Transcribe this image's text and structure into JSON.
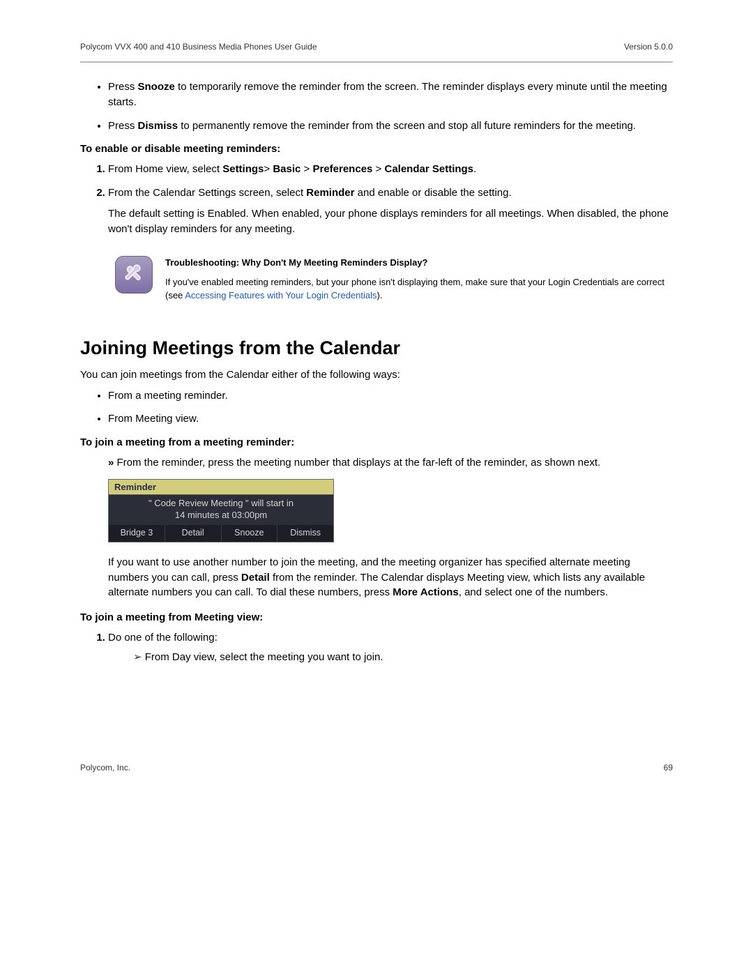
{
  "header": {
    "docTitle": "Polycom VVX 400 and 410 Business Media Phones User Guide",
    "version": "Version 5.0.0"
  },
  "bullets1": {
    "b1_pre": "Press ",
    "b1_bold": "Snooze",
    "b1_post": " to temporarily remove the reminder from the screen. The reminder displays every minute until the meeting starts.",
    "b2_pre": "Press ",
    "b2_bold": "Dismiss",
    "b2_post": " to permanently remove the reminder from the screen and stop all future reminders for the meeting."
  },
  "reminders": {
    "heading": "To enable or disable meeting reminders:",
    "step1_pre": "From Home view, select ",
    "step1_b1": "Settings",
    "step1_gt1": "> ",
    "step1_b2": "Basic",
    "step1_gt2": " > ",
    "step1_b3": "Preferences",
    "step1_gt3": " > ",
    "step1_b4": "Calendar Settings",
    "step1_post": ".",
    "step2_pre": "From the Calendar Settings screen, select ",
    "step2_bold": "Reminder",
    "step2_post": " and enable or disable the setting.",
    "note": "The default setting is Enabled. When enabled, your phone displays reminders for all meetings. When disabled, the phone won't display reminders for any meeting."
  },
  "tip": {
    "title": "Troubleshooting: Why Don't My Meeting Reminders Display?",
    "body_pre": "If you've enabled meeting reminders, but your phone isn't displaying them, make sure that your Login Credentials are correct (see ",
    "link": "Accessing Features with Your Login Credentials",
    "body_post": ")."
  },
  "section2": {
    "heading": "Joining Meetings from the Calendar",
    "intro": "You can join meetings from the Calendar either of the following ways:",
    "opt1": "From a meeting reminder.",
    "opt2": "From Meeting view.",
    "sub1_head": "To join a meeting from a meeting reminder:",
    "sub1_item": "From the reminder, press the meeting number that displays at the far-left of the reminder, as shown next.",
    "phone": {
      "title": "Reminder",
      "line1": "\" Code Review Meeting \" will start in",
      "line2": "14 minutes at 03:00pm",
      "btn1": "Bridge 3",
      "btn2": "Detail",
      "btn3": "Snooze",
      "btn4": "Dismiss"
    },
    "after_pre": "If you want to use another number to join the meeting, and the meeting organizer has specified alternate meeting numbers you can call, press ",
    "after_b1": "Detail",
    "after_mid": " from the reminder. The Calendar displays Meeting view, which lists any available alternate numbers you can call. To dial these numbers, press ",
    "after_b2": "More Actions",
    "after_post": ", and select one of the numbers.",
    "sub2_head": "To join a meeting from Meeting view:",
    "sub2_step1": "Do one of the following:",
    "sub2_sub": "From Day view, select the meeting you want to join."
  },
  "footer": {
    "company": "Polycom, Inc.",
    "pageNum": "69"
  }
}
